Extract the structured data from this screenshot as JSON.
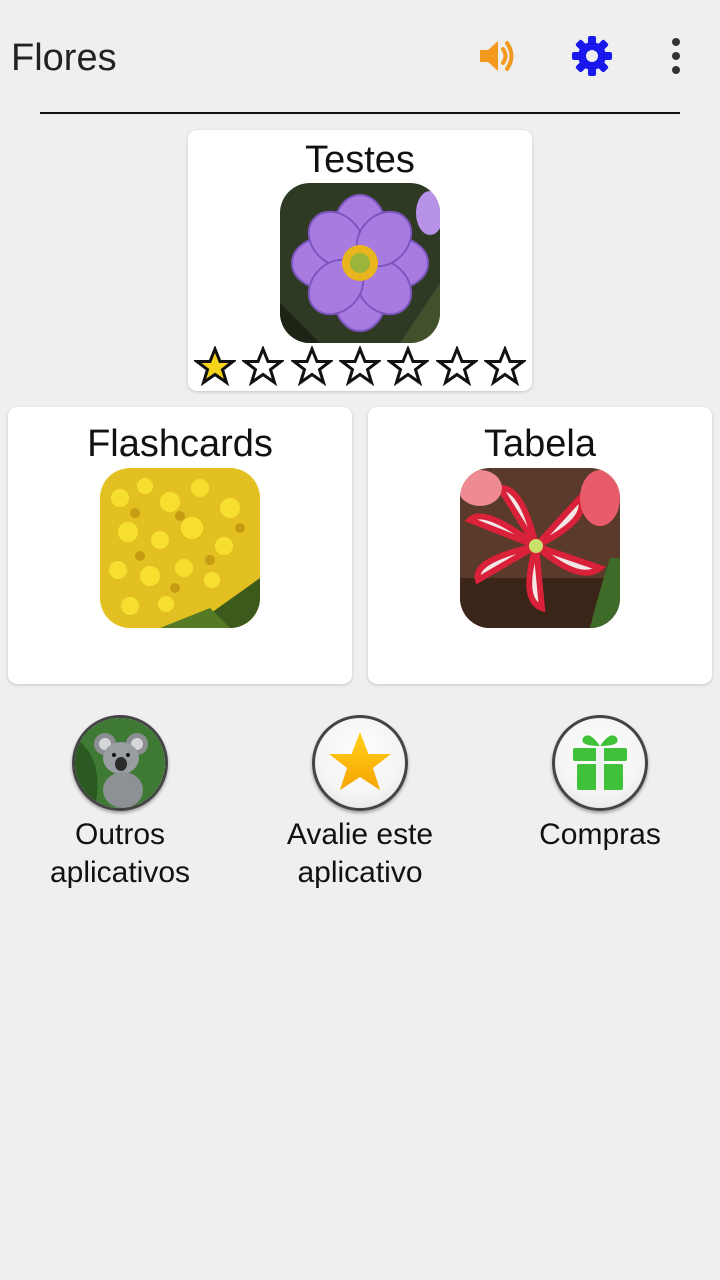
{
  "app": {
    "title": "Flores"
  },
  "toolbar": {
    "sound_icon": "speaker-icon",
    "settings_icon": "gear-icon",
    "more_icon": "more-vert-icon"
  },
  "colors": {
    "sound": "#f39a1e",
    "settings": "#1a17ee",
    "more": "#333333",
    "star_filled": "#f7d31a"
  },
  "cards": {
    "testes": {
      "label": "Testes",
      "image": "purple anemone flower",
      "stars_total": 7,
      "stars_filled": 1
    },
    "flashcards": {
      "label": "Flashcards",
      "image": "yellow mimosa flowers"
    },
    "tabela": {
      "label": "Tabela",
      "image": "red and white amaryllis"
    }
  },
  "bottom_buttons": [
    {
      "label_line1": "Outros",
      "label_line2": "aplicativos",
      "icon": "koala-icon"
    },
    {
      "label_line1": "Avalie este",
      "label_line2": "aplicativo",
      "icon": "star-icon"
    },
    {
      "label_line1": "Compras",
      "label_line2": "",
      "icon": "gift-icon"
    }
  ]
}
